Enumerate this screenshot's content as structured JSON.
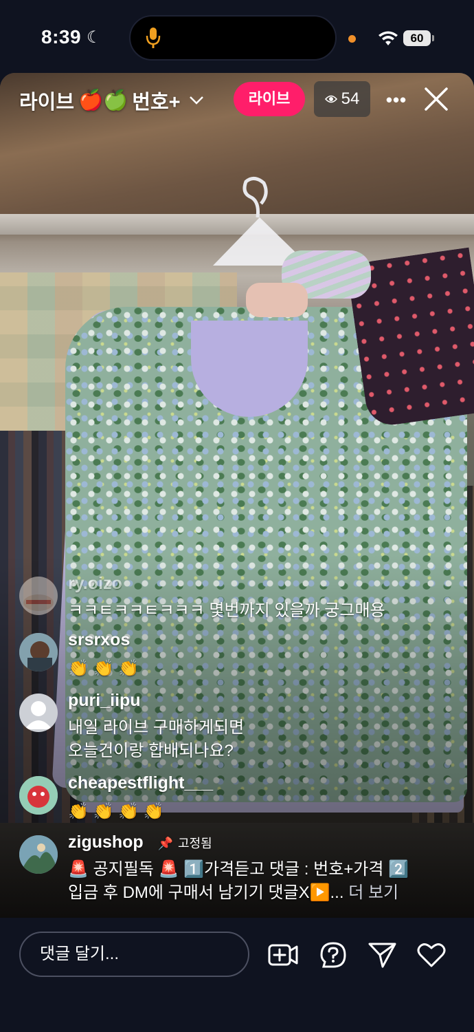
{
  "status_bar": {
    "time": "8:39",
    "battery": "60",
    "icons": [
      "moon-icon",
      "microphone-icon",
      "wifi-icon",
      "battery-icon"
    ]
  },
  "live_header": {
    "title": "라이브",
    "title_emojis": "🍎🍏",
    "title_suffix": "번호+",
    "live_badge": "라이브",
    "viewer_count": "54",
    "more_label": "•••"
  },
  "comments": [
    {
      "user": "ry.oizo",
      "text": "ㅋㅋㅌㅋㅋㅌㅋㅋㅋ 몇번까지 있을까 궁그매용"
    },
    {
      "user": "srsrxos",
      "text": "👏 👏 👏"
    },
    {
      "user": "puri_iipu",
      "line1": "내일 라이브 구매하게되면",
      "line2": "오늘건이랑 합배되나요?"
    },
    {
      "user": "cheapestflight___",
      "text": "👏 👏 👏 👏"
    },
    {
      "user": "zigushop",
      "pinned_label": "고정됨",
      "line1": "🚨 공지필독 🚨 1️⃣가격듣고 댓글 : 번호+가격 2️⃣",
      "line2": "입금 후 DM에 구매서 남기기 댓글X▶️...",
      "more": "더 보기"
    }
  ],
  "bottom_bar": {
    "input_placeholder": "댓글 달기...",
    "icons": [
      "add-video-icon",
      "question-icon",
      "send-icon",
      "heart-icon"
    ]
  },
  "colors": {
    "background": "#0f1320",
    "live_badge": "#ff1e6a",
    "mic": "#f0a020"
  }
}
